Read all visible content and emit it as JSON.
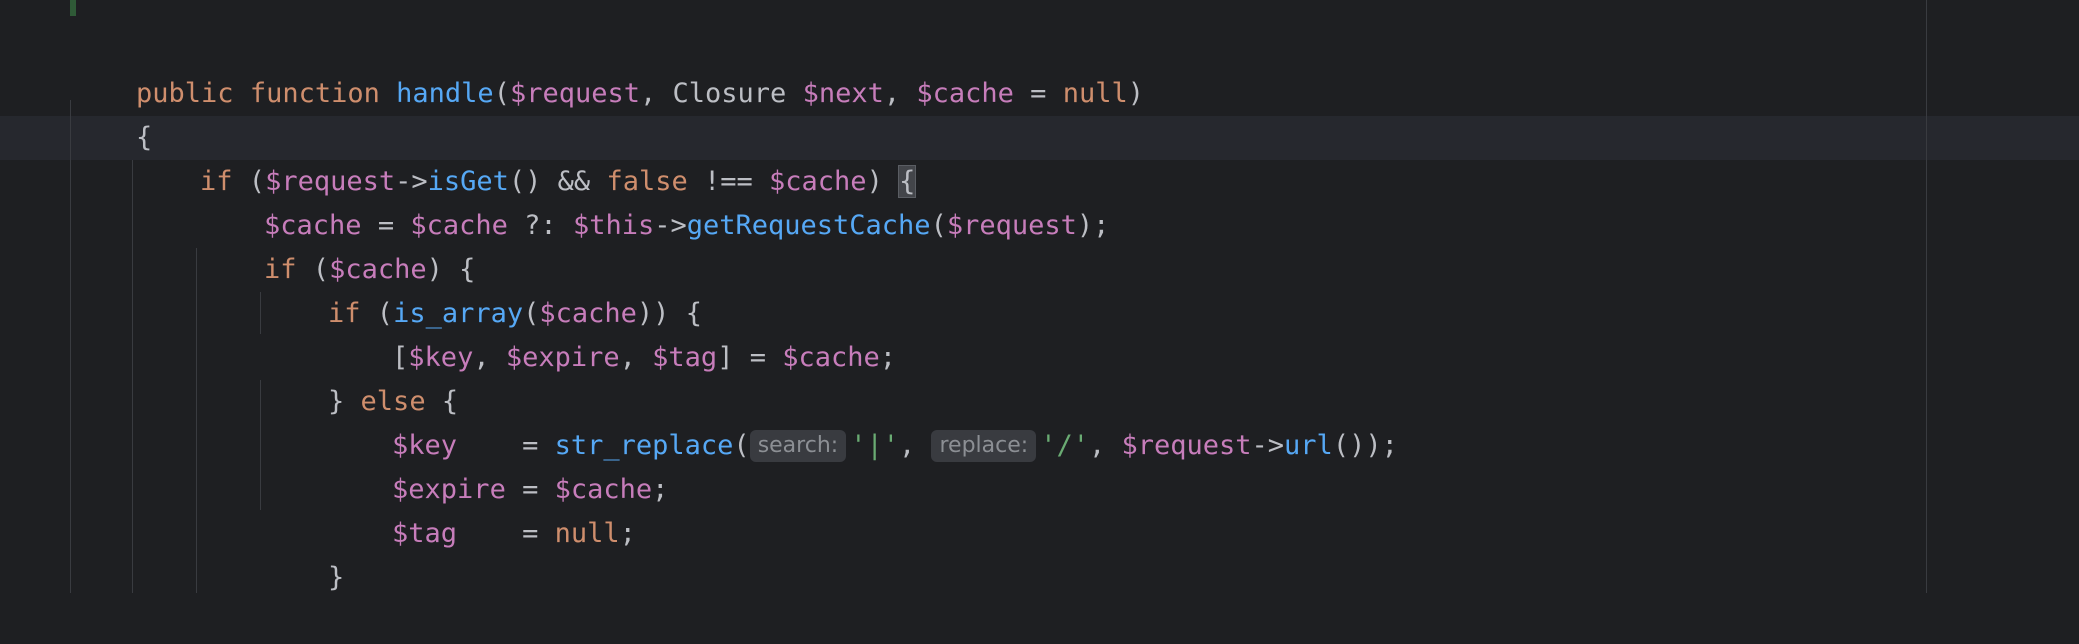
{
  "editor": {
    "language": "PHP",
    "theme_colors": {
      "background": "#1e1f22",
      "keyword": "#cf8e6d",
      "function": "#56a8f5",
      "variable": "#c77dbb",
      "string": "#6aab73",
      "text": "#bcbec4"
    },
    "lines": {
      "l1": {
        "t1": "public",
        "t2": " ",
        "t3": "function",
        "t4": " ",
        "t5": "handle",
        "t6": "(",
        "t7": "$request",
        "t8": ", Closure ",
        "t9": "$next",
        "t10": ", ",
        "t11": "$cache",
        "t12": " = ",
        "t13": "null",
        "t14": ")"
      },
      "l2": {
        "t1": "{"
      },
      "l3": {
        "t1": "if",
        "t2": " (",
        "t3": "$request",
        "t4": "->",
        "t5": "isGet",
        "t6": "() && ",
        "t7": "false",
        "t8": " !== ",
        "t9": "$cache",
        "t10": ") ",
        "t11": "{"
      },
      "l4": {
        "t1": "$cache",
        "t2": " = ",
        "t3": "$cache",
        "t4": " ?: ",
        "t5": "$this",
        "t6": "->",
        "t7": "getRequestCache",
        "t8": "(",
        "t9": "$request",
        "t10": ");"
      },
      "l5": {
        "t1": "if",
        "t2": " (",
        "t3": "$cache",
        "t4": ") {"
      },
      "l6": {
        "t1": "if",
        "t2": " (",
        "t3": "is_array",
        "t4": "(",
        "t5": "$cache",
        "t6": ")) {"
      },
      "l7": {
        "t1": "[",
        "t2": "$key",
        "t3": ", ",
        "t4": "$expire",
        "t5": ", ",
        "t6": "$tag",
        "t7": "] = ",
        "t8": "$cache",
        "t9": ";"
      },
      "l8": {
        "t1": "} ",
        "t2": "else",
        "t3": " {"
      },
      "l9": {
        "t1": "$key",
        "t2": "    = ",
        "t3": "str_replace",
        "t4": "(",
        "hint1": "search:",
        "t5": "'|'",
        "t6": ", ",
        "hint2": "replace:",
        "t7": "'/'",
        "t8": ", ",
        "t9": "$request",
        "t10": "->",
        "t11": "url",
        "t12": "());"
      },
      "l10": {
        "t1": "$expire",
        "t2": " = ",
        "t3": "$cache",
        "t4": ";"
      },
      "l11": {
        "t1": "$tag",
        "t2": "    = ",
        "t3": "null",
        "t4": ";"
      },
      "l12": {
        "t1": "}"
      }
    }
  }
}
